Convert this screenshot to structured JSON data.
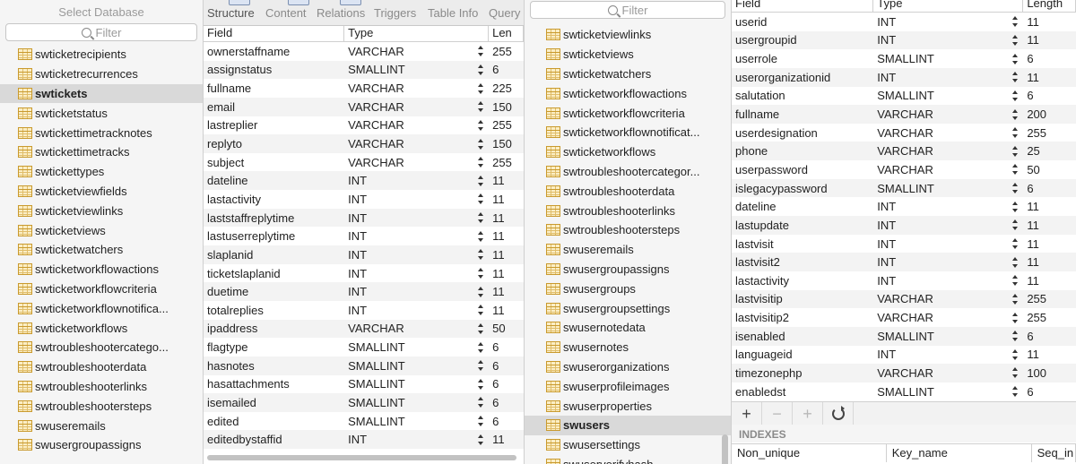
{
  "left_panel": {
    "title": "Select Database",
    "filter_placeholder": "Filter",
    "tables": [
      "swticketrecipients",
      "swticketrecurrences",
      "swtickets",
      "swticketstatus",
      "swtickettimetracknotes",
      "swtickettimetracks",
      "swtickettypes",
      "swticketviewfields",
      "swticketviewlinks",
      "swticketviews",
      "swticketwatchers",
      "swticketworkflowactions",
      "swticketworkflowcriteria",
      "swticketworkflownotifica...",
      "swticketworkflows",
      "swtroubleshootercatego...",
      "swtroubleshooterdata",
      "swtroubleshooterlinks",
      "swtroubleshootersteps",
      "swuseremails",
      "swusergroupassigns"
    ],
    "selected": "swtickets"
  },
  "tabs": [
    "Structure",
    "Content",
    "Relations",
    "Triggers",
    "Table Info",
    "Query"
  ],
  "active_tab": "Structure",
  "structure": {
    "columns": [
      "Field",
      "Type",
      "Len"
    ],
    "rows": [
      [
        "ownerstaffname",
        "VARCHAR",
        "255"
      ],
      [
        "assignstatus",
        "SMALLINT",
        "6"
      ],
      [
        "fullname",
        "VARCHAR",
        "225"
      ],
      [
        "email",
        "VARCHAR",
        "150"
      ],
      [
        "lastreplier",
        "VARCHAR",
        "255"
      ],
      [
        "replyto",
        "VARCHAR",
        "150"
      ],
      [
        "subject",
        "VARCHAR",
        "255"
      ],
      [
        "dateline",
        "INT",
        "11"
      ],
      [
        "lastactivity",
        "INT",
        "11"
      ],
      [
        "laststaffreplytime",
        "INT",
        "11"
      ],
      [
        "lastuserreplytime",
        "INT",
        "11"
      ],
      [
        "slaplanid",
        "INT",
        "11"
      ],
      [
        "ticketslaplanid",
        "INT",
        "11"
      ],
      [
        "duetime",
        "INT",
        "11"
      ],
      [
        "totalreplies",
        "INT",
        "11"
      ],
      [
        "ipaddress",
        "VARCHAR",
        "50"
      ],
      [
        "flagtype",
        "SMALLINT",
        "6"
      ],
      [
        "hasnotes",
        "SMALLINT",
        "6"
      ],
      [
        "hasattachments",
        "SMALLINT",
        "6"
      ],
      [
        "isemailed",
        "SMALLINT",
        "6"
      ],
      [
        "edited",
        "SMALLINT",
        "6"
      ],
      [
        "editedbystaffid",
        "INT",
        "11"
      ]
    ]
  },
  "second_list": {
    "filter_placeholder": "Filter",
    "tables": [
      "swticketviewlinks",
      "swticketviews",
      "swticketwatchers",
      "swticketworkflowactions",
      "swticketworkflowcriteria",
      "swticketworkflownotificat...",
      "swticketworkflows",
      "swtroubleshootercategor...",
      "swtroubleshooterdata",
      "swtroubleshooterlinks",
      "swtroubleshootersteps",
      "swuseremails",
      "swusergroupassigns",
      "swusergroups",
      "swusergroupsettings",
      "swusernotedata",
      "swusernotes",
      "swuserorganizations",
      "swuserprofileimages",
      "swuserproperties",
      "swusers",
      "swusersettings",
      "swuserverifyhash"
    ],
    "selected": "swusers"
  },
  "user_structure": {
    "columns": [
      "Field",
      "Type",
      "Length"
    ],
    "rows": [
      [
        "userid",
        "INT",
        "11"
      ],
      [
        "usergroupid",
        "INT",
        "11"
      ],
      [
        "userrole",
        "SMALLINT",
        "6"
      ],
      [
        "userorganizationid",
        "INT",
        "11"
      ],
      [
        "salutation",
        "SMALLINT",
        "6"
      ],
      [
        "fullname",
        "VARCHAR",
        "200"
      ],
      [
        "userdesignation",
        "VARCHAR",
        "255"
      ],
      [
        "phone",
        "VARCHAR",
        "25"
      ],
      [
        "userpassword",
        "VARCHAR",
        "50"
      ],
      [
        "islegacypassword",
        "SMALLINT",
        "6"
      ],
      [
        "dateline",
        "INT",
        "11"
      ],
      [
        "lastupdate",
        "INT",
        "11"
      ],
      [
        "lastvisit",
        "INT",
        "11"
      ],
      [
        "lastvisit2",
        "INT",
        "11"
      ],
      [
        "lastactivity",
        "INT",
        "11"
      ],
      [
        "lastvisitip",
        "VARCHAR",
        "255"
      ],
      [
        "lastvisitip2",
        "VARCHAR",
        "255"
      ],
      [
        "isenabled",
        "SMALLINT",
        "6"
      ],
      [
        "languageid",
        "INT",
        "11"
      ],
      [
        "timezonephp",
        "VARCHAR",
        "100"
      ],
      [
        "enabledst",
        "SMALLINT",
        "6"
      ]
    ]
  },
  "toolbar": {
    "add": "+",
    "remove": "−",
    "duplicate": "+"
  },
  "indexes": {
    "title": "INDEXES",
    "columns": [
      "Non_unique",
      "Key_name",
      "Seq_in"
    ]
  }
}
